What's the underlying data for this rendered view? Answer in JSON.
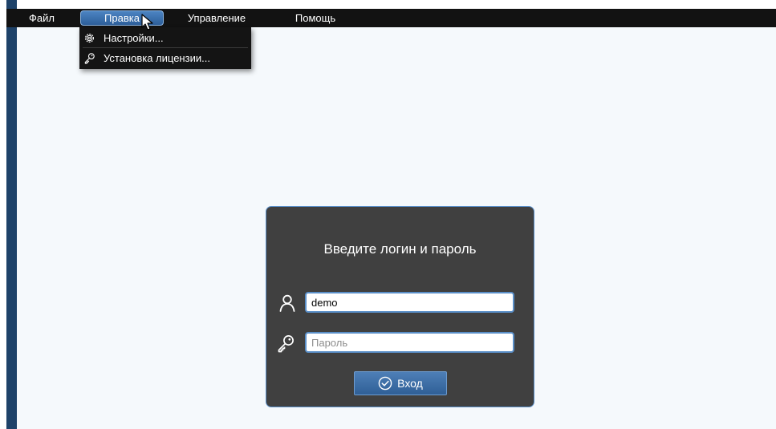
{
  "menubar": {
    "items": [
      {
        "label": "Файл"
      },
      {
        "label": "Правка"
      },
      {
        "label": "Управление"
      },
      {
        "label": "Помощь"
      }
    ]
  },
  "edit_menu": {
    "items": [
      {
        "label": "Настройки...",
        "icon": "gear-icon"
      },
      {
        "label": "Установка лицензии...",
        "icon": "key-icon"
      }
    ]
  },
  "login_dialog": {
    "title": "Введите логин и пароль",
    "username": {
      "value": "demo",
      "icon": "user-icon"
    },
    "password": {
      "placeholder": "Пароль",
      "icon": "key-icon"
    },
    "submit_label": "Вход"
  },
  "colors": {
    "accent": "#5a8fc8",
    "menubar_bg": "#121212",
    "dialog_bg": "#404040",
    "content_bg": "#f5f9fc",
    "left_strip": "#1e4269"
  }
}
